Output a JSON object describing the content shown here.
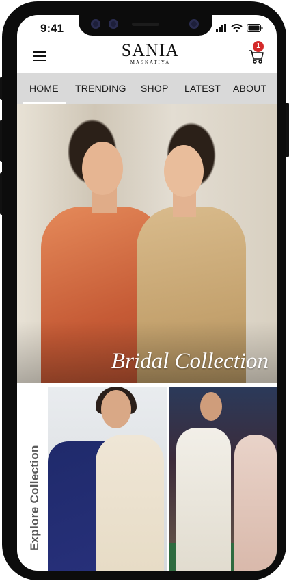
{
  "status_bar": {
    "time": "9:41"
  },
  "header": {
    "brand_name": "SANIA",
    "brand_sub": "MASKATIYA",
    "cart_count": "1",
    "menu_icon": "hamburger-icon",
    "cart_icon": "shopping-cart-icon"
  },
  "nav": {
    "items": [
      {
        "label": "HOME"
      },
      {
        "label": "TRENDING"
      },
      {
        "label": "SHOP"
      },
      {
        "label": "LATEST"
      },
      {
        "label": "ABOUT"
      }
    ],
    "active": "HOME"
  },
  "hero": {
    "caption": "Bridal Collection"
  },
  "explore": {
    "label": "Explore Collection"
  },
  "colors": {
    "nav_bg": "#d9d9d9",
    "badge": "#d42a2a",
    "text": "#111111"
  }
}
